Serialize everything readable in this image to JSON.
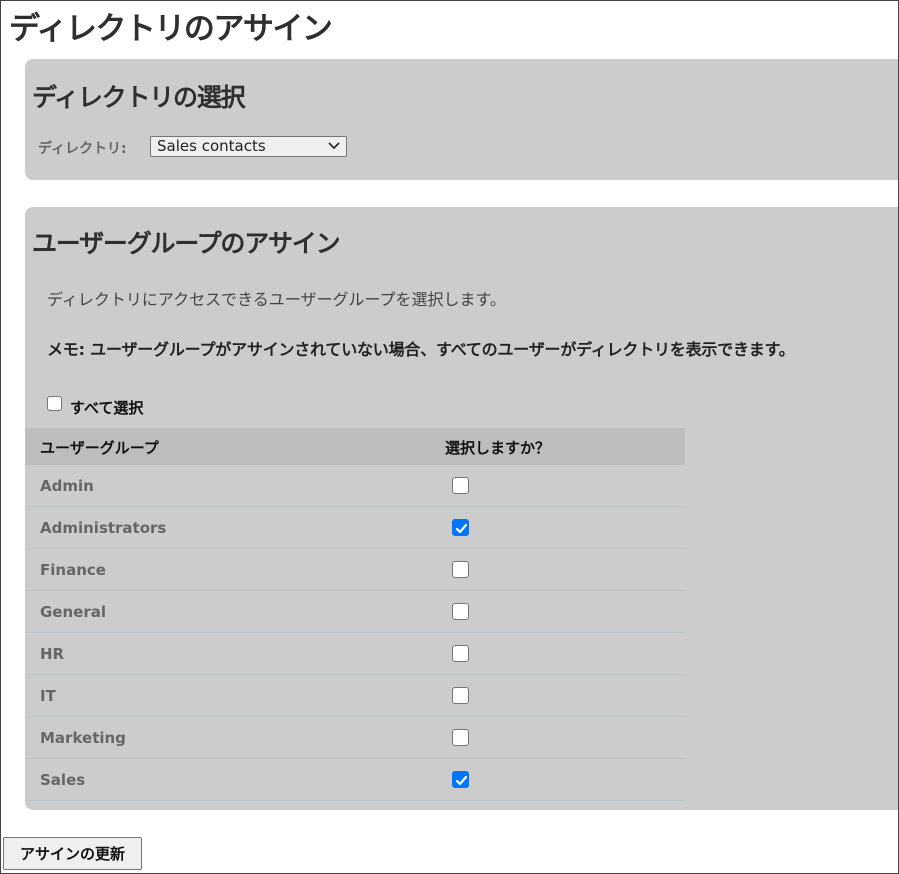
{
  "page": {
    "title": "ディレクトリのアサイン"
  },
  "directory_section": {
    "heading": "ディレクトリの選択",
    "label": "ディレクトリ:",
    "selected_directory": "Sales contacts"
  },
  "groups_section": {
    "heading": "ユーザーグループのアサイン",
    "description": "ディレクトリにアクセスできるユーザーグループを選択します。",
    "note": "メモ: ユーザーグループがアサインされていない場合、すべてのユーザーがディレクトリを表示できます。",
    "select_all_label": "すべて選択",
    "select_all_checked": false,
    "table": {
      "headers": [
        "ユーザーグループ",
        "選択しますか？"
      ],
      "rows": [
        {
          "name": "Admin",
          "selected": false
        },
        {
          "name": "Administrators",
          "selected": true
        },
        {
          "name": "Finance",
          "selected": false
        },
        {
          "name": "General",
          "selected": false
        },
        {
          "name": "HR",
          "selected": false
        },
        {
          "name": "IT",
          "selected": false
        },
        {
          "name": "Marketing",
          "selected": false
        },
        {
          "name": "Sales",
          "selected": true
        }
      ]
    }
  },
  "actions": {
    "update_label": "アサインの更新"
  },
  "colors": {
    "panel_bg": "#cccccc",
    "header_bg": "#bdbdbd",
    "checkbox_checked": "#0075ff",
    "row_divider": "#b9c7cf"
  }
}
